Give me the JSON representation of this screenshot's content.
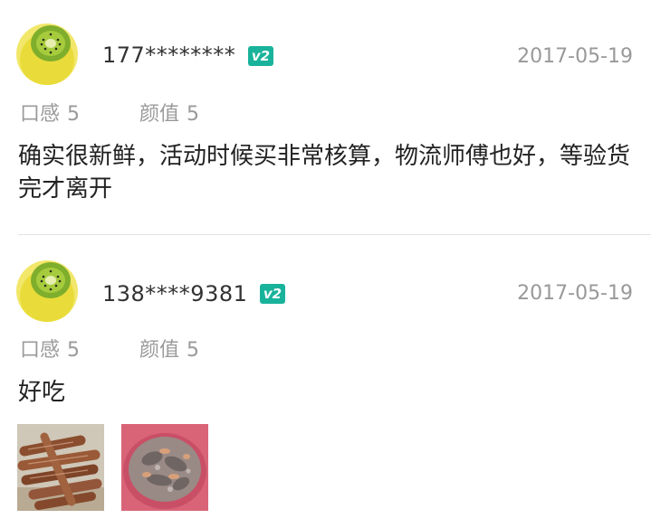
{
  "reviews": [
    {
      "user": "177********",
      "badge": "v2",
      "date": "2017-05-19",
      "taste_label": "口感",
      "taste_score": "5",
      "look_label": "颜值",
      "look_score": "5",
      "text": "确实很新鲜，活动时候买非常核算，物流师傅也好，等验货完才离开",
      "avatar_icon": "kiwi-avatar-icon"
    },
    {
      "user": "138****9381",
      "badge": "v2",
      "date": "2017-05-19",
      "taste_label": "口感",
      "taste_score": "5",
      "look_label": "颜值",
      "look_score": "5",
      "text": "好吃",
      "avatar_icon": "kiwi-avatar-icon",
      "photos": [
        "cooked-roots-photo",
        "seafood-bowl-photo"
      ]
    }
  ],
  "colors": {
    "badge": "#19b39b",
    "muted_text": "#999999",
    "divider": "#e3e3e3"
  }
}
